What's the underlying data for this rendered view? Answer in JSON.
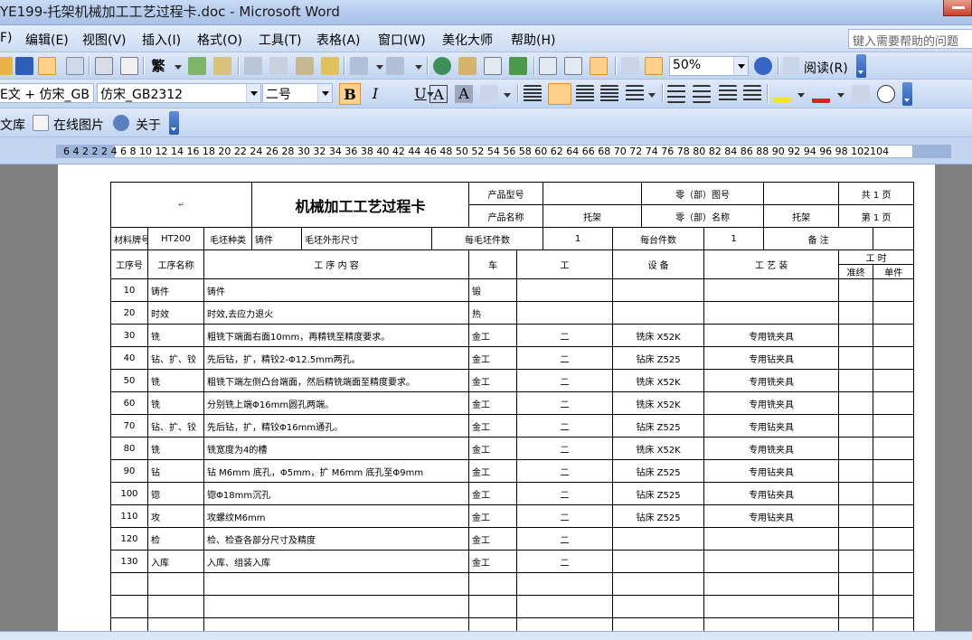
{
  "window": {
    "title": "YE199-托架机械加工工艺过程卡.doc - Microsoft Word"
  },
  "menu": {
    "items": [
      "F)",
      "编辑(E)",
      "视图(V)",
      "插入(I)",
      "格式(O)",
      "工具(T)",
      "表格(A)",
      "窗口(W)",
      "美化大师",
      "帮助(H)"
    ],
    "help_placeholder": "键入需要帮助的问题"
  },
  "toolbar1": {
    "zoom": "50%",
    "read_label": "阅读(R)",
    "trad_char": "繁"
  },
  "toolbar2": {
    "style_combo": "E文 + 仿宋_GB",
    "font_combo": "仿宋_GB2312",
    "size_combo": "二号",
    "bold": "B",
    "italic": "I",
    "underline": "U",
    "char_border": "A",
    "char_shade": "A"
  },
  "toolbar3": {
    "library_label": "文库",
    "online_pic_label": "在线图片",
    "about_label": "关于"
  },
  "ruler": {
    "numbers": "6  4  2  2  2  4  6  8  10 12 14 16 18 20 22 24 26 28 30 32 34 36 38 40 42 44 46 48 50 52 54 56 58 60 62 64 66 68 70 72 74 76 78 80 82 84 86 88 90 92 94 96 98  102104"
  },
  "card": {
    "title": "机械加工工艺过程卡",
    "product_model_label": "产品型号",
    "product_name_label": "产品名称",
    "product_name": "托架",
    "part_no_label": "零（部）图号",
    "part_name_label": "零（部）名称",
    "part_name": "托架",
    "total_pages": "共 1 页",
    "page_no": "第 1 页",
    "material_label": "材料牌号",
    "material": "HT200",
    "blank_type_label": "毛坯种类",
    "blank_type": "铸件",
    "blank_size_label": "毛坯外形尺寸",
    "per_blank_label": "每毛坯件数",
    "per_blank": "1",
    "per_unit_label": "每台件数",
    "per_unit": "1",
    "remarks_label": "备 注",
    "headers": {
      "op_no": "工序号",
      "op_name": "工序名称",
      "content": "工    序    内    容",
      "shop": "车",
      "section": "工",
      "equipment": "设 备",
      "tooling": "工  艺  装",
      "hours": "工    时",
      "prep": "准终",
      "unit": "单件"
    },
    "rows": [
      {
        "no": "10",
        "name": "铸件",
        "content": "铸件",
        "shop": "锻",
        "section": "",
        "equip": "",
        "tool": ""
      },
      {
        "no": "20",
        "name": "时效",
        "content": "时效,去应力退火",
        "shop": "热",
        "section": "",
        "equip": "",
        "tool": ""
      },
      {
        "no": "30",
        "name": "铣",
        "content": "粗铣下端面右面10mm，再精铣至精度要求。",
        "shop": "金工",
        "section": "二",
        "equip": "铣床 X52K",
        "tool": "专用铣夹具"
      },
      {
        "no": "40",
        "name": "钻、扩、铰",
        "content": "先后钻，扩，精铰2-Φ12.5mm两孔。",
        "shop": "金工",
        "section": "二",
        "equip": "钻床 Z525",
        "tool": "专用钻夹具"
      },
      {
        "no": "50",
        "name": "铣",
        "content": "粗铣下端左侧凸台端面，然后精铣端面至精度要求。",
        "shop": "金工",
        "section": "二",
        "equip": "铣床 X52K",
        "tool": "专用铣夹具"
      },
      {
        "no": "60",
        "name": "铣",
        "content": "分别铣上端Φ16mm圆孔两端。",
        "shop": "金工",
        "section": "二",
        "equip": "铣床 X52K",
        "tool": "专用铣夹具"
      },
      {
        "no": "70",
        "name": "钻、扩、铰",
        "content": "先后钻，扩，精铰Φ16mm通孔。",
        "shop": "金工",
        "section": "二",
        "equip": "钻床 Z525",
        "tool": "专用钻夹具"
      },
      {
        "no": "80",
        "name": "铣",
        "content": "铣宽度为4的槽",
        "shop": "金工",
        "section": "二",
        "equip": "铣床 X52K",
        "tool": "专用铣夹具"
      },
      {
        "no": "90",
        "name": "钻",
        "content": "钻 M6mm 底孔，Φ5mm，扩 M6mm 底孔至Φ9mm",
        "shop": "金工",
        "section": "二",
        "equip": "钻床 Z525",
        "tool": "专用钻夹具"
      },
      {
        "no": "100",
        "name": "锪",
        "content": "锪Φ18mm沉孔",
        "shop": "金工",
        "section": "二",
        "equip": "钻床 Z525",
        "tool": "专用钻夹具"
      },
      {
        "no": "110",
        "name": "攻",
        "content": "攻螺纹M6mm",
        "shop": "金工",
        "section": "二",
        "equip": "钻床 Z525",
        "tool": "专用钻夹具"
      },
      {
        "no": "120",
        "name": "检",
        "content": "检、检查各部分尺寸及精度",
        "shop": "金工",
        "section": "二",
        "equip": "",
        "tool": ""
      },
      {
        "no": "130",
        "name": "入库",
        "content": "入库、组装入库",
        "shop": "金工",
        "section": "二",
        "equip": "",
        "tool": ""
      },
      {
        "no": "",
        "name": "",
        "content": "",
        "shop": "",
        "section": "",
        "equip": "",
        "tool": ""
      },
      {
        "no": "",
        "name": "",
        "content": "",
        "shop": "",
        "section": "",
        "equip": "",
        "tool": ""
      },
      {
        "no": "",
        "name": "",
        "content": "",
        "shop": "",
        "section": "",
        "equip": "",
        "tool": ""
      }
    ]
  },
  "colors": {
    "titlebar": "#b7cdee",
    "toolbar": "#cddcf3",
    "active_button": "#ffd08a",
    "doc_bg": "#808080"
  }
}
